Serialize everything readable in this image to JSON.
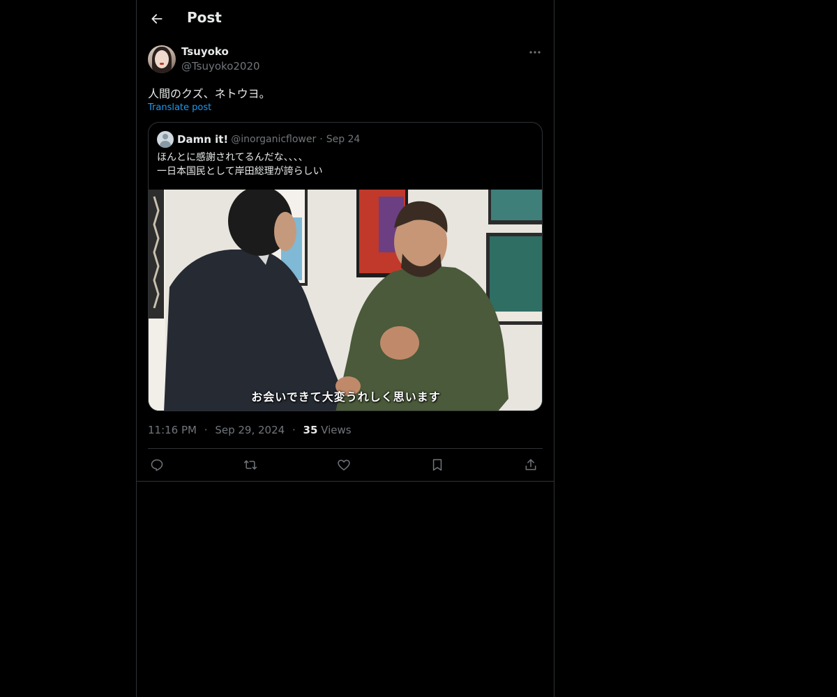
{
  "header": {
    "title": "Post",
    "back_icon": "arrow-left-icon"
  },
  "post": {
    "author": {
      "display_name": "Tsuyoko",
      "handle": "@Tsuyoko2020"
    },
    "text": "人間のクズ、ネトウヨ。",
    "translate_label": "Translate post",
    "more_icon": "more-horizontal-icon",
    "quoted": {
      "display_name": "Damn it!",
      "handle": "@inorganicflower",
      "separator": "·",
      "date": "Sep 24",
      "text_lines": [
        "ほんとに感謝されてるんだな、、、、",
        "一日本国民として岸田総理が誇らしい"
      ],
      "media_subtitle": "お会いできて大変うれしく思います"
    },
    "meta": {
      "time": "11:16 PM",
      "separator": "·",
      "date": "Sep 29, 2024",
      "views_count": "35",
      "views_label": "Views"
    },
    "actions": [
      {
        "name": "reply",
        "icon": "reply-icon"
      },
      {
        "name": "repost",
        "icon": "repost-icon"
      },
      {
        "name": "like",
        "icon": "heart-icon"
      },
      {
        "name": "bookmark",
        "icon": "bookmark-icon"
      },
      {
        "name": "share",
        "icon": "share-icon"
      }
    ]
  },
  "colors": {
    "background": "#000000",
    "text_primary": "#e7e9ea",
    "text_secondary": "#71767b",
    "link": "#1d9bf0",
    "border": "#2f3336"
  }
}
